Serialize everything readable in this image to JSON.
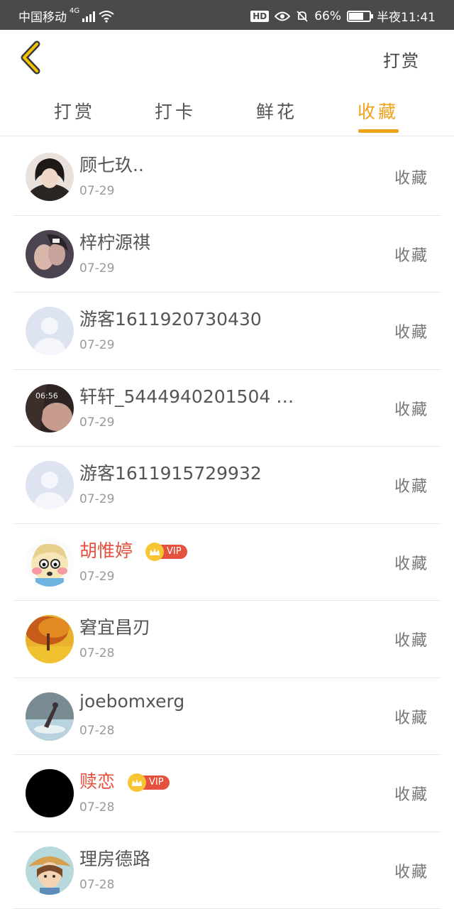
{
  "status_bar": {
    "carrier": "中国移动",
    "network": "4G",
    "battery_percent": "66%",
    "battery_level": 0.66,
    "time": "半夜11:41",
    "hd_label": "HD"
  },
  "header": {
    "right_label": "打赏"
  },
  "tabs": [
    {
      "label": "打赏",
      "active": false
    },
    {
      "label": "打卡",
      "active": false
    },
    {
      "label": "鲜花",
      "active": false
    },
    {
      "label": "收藏",
      "active": true
    }
  ],
  "colors": {
    "accent": "#f0a21b",
    "vip_name": "#e4503e",
    "status_bar": "#4a4a4a"
  },
  "items": [
    {
      "name": "顾七玖..",
      "date": "07-29",
      "action": "收藏",
      "vip": false,
      "avatar": "photo-girl"
    },
    {
      "name": "梓柠源祺",
      "date": "07-29",
      "action": "收藏",
      "vip": false,
      "avatar": "photo-couple"
    },
    {
      "name": "游客1611920730430",
      "date": "07-29",
      "action": "收藏",
      "vip": false,
      "avatar": "default-user"
    },
    {
      "name": "轩轩_5444940201504 …",
      "date": "07-29",
      "action": "收藏",
      "vip": false,
      "avatar": "photo-dark"
    },
    {
      "name": "游客1611915729932",
      "date": "07-29",
      "action": "收藏",
      "vip": false,
      "avatar": "default-user"
    },
    {
      "name": "胡惟婷",
      "date": "07-29",
      "action": "收藏",
      "vip": true,
      "vip_label": "VIP",
      "avatar": "cartoon"
    },
    {
      "name": "窘宜昌刃",
      "date": "07-28",
      "action": "收藏",
      "vip": false,
      "avatar": "autumn-tree"
    },
    {
      "name": "joebomxerg",
      "date": "07-28",
      "action": "收藏",
      "vip": false,
      "avatar": "photo-water"
    },
    {
      "name": "赎恋",
      "date": "07-28",
      "action": "收藏",
      "vip": true,
      "vip_label": "VIP",
      "avatar": "black"
    },
    {
      "name": "理房德路",
      "date": "07-28",
      "action": "收藏",
      "vip": false,
      "avatar": "cartoon-girl"
    }
  ]
}
